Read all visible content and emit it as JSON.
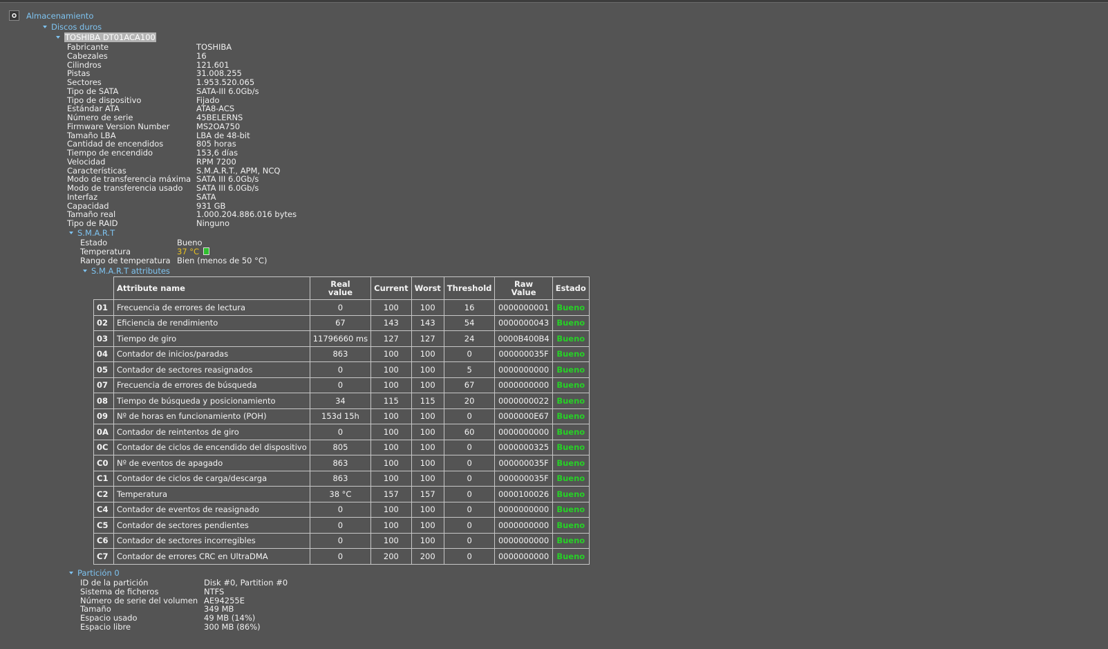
{
  "tree": {
    "root_label": "Almacenamiento",
    "group_label": "Discos duros",
    "disk_label": "TOSHIBA DT01ACA100",
    "smart_label": "S.M.A.R.T",
    "attributes_label": "S.M.A.R.T attributes",
    "partition_label": "Partición 0"
  },
  "disk_props": [
    {
      "key": "Fabricante",
      "value": "TOSHIBA"
    },
    {
      "key": "Cabezales",
      "value": "16"
    },
    {
      "key": "Cilindros",
      "value": "121.601"
    },
    {
      "key": "Pistas",
      "value": "31.008.255"
    },
    {
      "key": "Sectores",
      "value": "1.953.520.065"
    },
    {
      "key": "Tipo de SATA",
      "value": "SATA-III 6.0Gb/s"
    },
    {
      "key": "Tipo de dispositivo",
      "value": "Fijado"
    },
    {
      "key": "Estándar ATA",
      "value": "ATA8-ACS"
    },
    {
      "key": "Número de serie",
      "value": "45BELERNS"
    },
    {
      "key": "Firmware Version Number",
      "value": "MS2OA750"
    },
    {
      "key": "Tamaño LBA",
      "value": "LBA de 48-bit"
    },
    {
      "key": "Cantidad de encendidos",
      "value": "805 horas"
    },
    {
      "key": "Tiempo de encendido",
      "value": "153,6 días"
    },
    {
      "key": "Velocidad",
      "value": "RPM 7200"
    },
    {
      "key": "Características",
      "value": "S.M.A.R.T., APM, NCQ"
    },
    {
      "key": "Modo de transferencia máxima",
      "value": "SATA III 6.0Gb/s"
    },
    {
      "key": "Modo de transferencia usado",
      "value": "SATA III 6.0Gb/s"
    },
    {
      "key": "Interfaz",
      "value": "SATA"
    },
    {
      "key": "Capacidad",
      "value": "931 GB"
    },
    {
      "key": "Tamaño real",
      "value": "1.000.204.886.016 bytes"
    },
    {
      "key": "Tipo de RAID",
      "value": "Ninguno"
    }
  ],
  "smart": {
    "estado_key": "Estado",
    "estado_value": "Bueno",
    "temp_key": "Temperatura",
    "temp_value": "37 °C",
    "rango_key": "Rango de temperatura",
    "rango_value": "Bien (menos de 50 °C)",
    "temp_indicator_color": "#2fbf2f"
  },
  "smart_table": {
    "headers": {
      "name": "Attribute name",
      "real_1": "Real",
      "real_2": "value",
      "current": "Current",
      "worst": "Worst",
      "threshold": "Threshold",
      "raw_1": "Raw",
      "raw_2": "Value",
      "estado": "Estado"
    },
    "status_color": "#27d027",
    "rows": [
      {
        "id": "01",
        "name": "Frecuencia de errores de lectura",
        "real": "0",
        "current": "100",
        "worst": "100",
        "threshold": "16",
        "raw": "0000000001",
        "estado": "Bueno"
      },
      {
        "id": "02",
        "name": "Eficiencia de rendimiento",
        "real": "67",
        "current": "143",
        "worst": "143",
        "threshold": "54",
        "raw": "0000000043",
        "estado": "Bueno"
      },
      {
        "id": "03",
        "name": "Tiempo de giro",
        "real": "11796660 ms",
        "current": "127",
        "worst": "127",
        "threshold": "24",
        "raw": "0000B400B4",
        "estado": "Bueno"
      },
      {
        "id": "04",
        "name": "Contador de inicios/paradas",
        "real": "863",
        "current": "100",
        "worst": "100",
        "threshold": "0",
        "raw": "000000035F",
        "estado": "Bueno"
      },
      {
        "id": "05",
        "name": "Contador de sectores reasignados",
        "real": "0",
        "current": "100",
        "worst": "100",
        "threshold": "5",
        "raw": "0000000000",
        "estado": "Bueno"
      },
      {
        "id": "07",
        "name": "Frecuencia de errores de búsqueda",
        "real": "0",
        "current": "100",
        "worst": "100",
        "threshold": "67",
        "raw": "0000000000",
        "estado": "Bueno"
      },
      {
        "id": "08",
        "name": "Tiempo de búsqueda y posicionamiento",
        "real": "34",
        "current": "115",
        "worst": "115",
        "threshold": "20",
        "raw": "0000000022",
        "estado": "Bueno"
      },
      {
        "id": "09",
        "name": "Nº de horas en funcionamiento (POH)",
        "real": "153d 15h",
        "current": "100",
        "worst": "100",
        "threshold": "0",
        "raw": "0000000E67",
        "estado": "Bueno"
      },
      {
        "id": "0A",
        "name": "Contador de reintentos de giro",
        "real": "0",
        "current": "100",
        "worst": "100",
        "threshold": "60",
        "raw": "0000000000",
        "estado": "Bueno"
      },
      {
        "id": "0C",
        "name": "Contador de ciclos de encendido del dispositivo",
        "real": "805",
        "current": "100",
        "worst": "100",
        "threshold": "0",
        "raw": "0000000325",
        "estado": "Bueno"
      },
      {
        "id": "C0",
        "name": "Nº de eventos de apagado",
        "real": "863",
        "current": "100",
        "worst": "100",
        "threshold": "0",
        "raw": "000000035F",
        "estado": "Bueno"
      },
      {
        "id": "C1",
        "name": "Contador de ciclos de carga/descarga",
        "real": "863",
        "current": "100",
        "worst": "100",
        "threshold": "0",
        "raw": "000000035F",
        "estado": "Bueno"
      },
      {
        "id": "C2",
        "name": "Temperatura",
        "real": "38 °C",
        "current": "157",
        "worst": "157",
        "threshold": "0",
        "raw": "0000100026",
        "estado": "Bueno"
      },
      {
        "id": "C4",
        "name": "Contador de eventos de reasignado",
        "real": "0",
        "current": "100",
        "worst": "100",
        "threshold": "0",
        "raw": "0000000000",
        "estado": "Bueno"
      },
      {
        "id": "C5",
        "name": "Contador de sectores pendientes",
        "real": "0",
        "current": "100",
        "worst": "100",
        "threshold": "0",
        "raw": "0000000000",
        "estado": "Bueno"
      },
      {
        "id": "C6",
        "name": "Contador de sectores incorregibles",
        "real": "0",
        "current": "100",
        "worst": "100",
        "threshold": "0",
        "raw": "0000000000",
        "estado": "Bueno"
      },
      {
        "id": "C7",
        "name": "Contador de errores CRC en UltraDMA",
        "real": "0",
        "current": "200",
        "worst": "200",
        "threshold": "0",
        "raw": "0000000000",
        "estado": "Bueno"
      }
    ]
  },
  "partition_props": [
    {
      "key": "ID de la partición",
      "value": "Disk #0, Partition #0"
    },
    {
      "key": "Sistema de ficheros",
      "value": "NTFS"
    },
    {
      "key": "Número de serie del volumen",
      "value": "AE94255E"
    },
    {
      "key": "Tamaño",
      "value": "349 MB"
    },
    {
      "key": "Espacio usado",
      "value": "49 MB (14%)"
    },
    {
      "key": "Espacio libre",
      "value": "300 MB (86%)"
    }
  ]
}
